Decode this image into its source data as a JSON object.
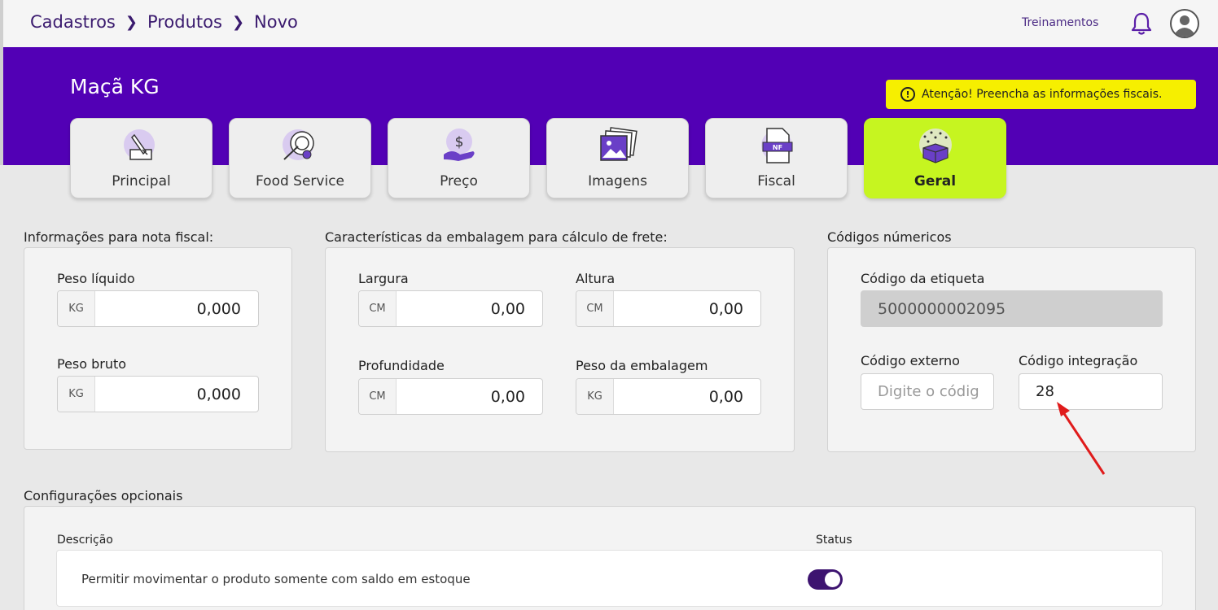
{
  "breadcrumb": [
    "Cadastros",
    "Produtos",
    "Novo"
  ],
  "header": {
    "link": "Treinamentos",
    "bell_icon": "bell-icon",
    "avatar_icon": "user-avatar-icon"
  },
  "product": {
    "title": "Maçã KG"
  },
  "alert": {
    "text": "Atenção! Preencha as informações fiscais.",
    "icon": "!",
    "color": "#f6ef00"
  },
  "tabs": [
    {
      "label": "Principal",
      "icon": "edit-icon"
    },
    {
      "label": "Food Service",
      "icon": "food-service-icon"
    },
    {
      "label": "Preço",
      "icon": "price-icon"
    },
    {
      "label": "Imagens",
      "icon": "images-icon"
    },
    {
      "label": "Fiscal",
      "icon": "nf-document-icon"
    },
    {
      "label": "Geral",
      "icon": "box-icon",
      "active": true
    }
  ],
  "nota_fiscal": {
    "title": "Informações para nota fiscal:",
    "peso_liquido": {
      "label": "Peso líquido",
      "unit": "KG",
      "value": "0,000"
    },
    "peso_bruto": {
      "label": "Peso bruto",
      "unit": "KG",
      "value": "0,000"
    }
  },
  "embalagem": {
    "title": "Características da embalagem para cálculo de frete:",
    "largura": {
      "label": "Largura",
      "unit": "CM",
      "value": "0,00"
    },
    "altura": {
      "label": "Altura",
      "unit": "CM",
      "value": "0,00"
    },
    "profundidade": {
      "label": "Profundidade",
      "unit": "CM",
      "value": "0,00"
    },
    "peso_embalagem": {
      "label": "Peso da embalagem",
      "unit": "KG",
      "value": "0,00"
    }
  },
  "codigos": {
    "title": "Códigos númericos",
    "etiqueta": {
      "label": "Código da etiqueta",
      "value": "5000000002095"
    },
    "externo": {
      "label": "Código externo",
      "placeholder": "Digite o códig"
    },
    "integracao": {
      "label": "Código integração",
      "value": "28"
    }
  },
  "opcionais": {
    "title": "Configurações opcionais",
    "col_descricao": "Descrição",
    "col_status": "Status",
    "rows": [
      {
        "descricao": "Permitir movimentar o produto somente com saldo em estoque",
        "status": true
      }
    ]
  },
  "colors": {
    "brand_purple": "#5200b5",
    "active_tab": "#c6f520",
    "toggle_on": "#3d1370",
    "annotation_arrow": "#e01b1b"
  }
}
